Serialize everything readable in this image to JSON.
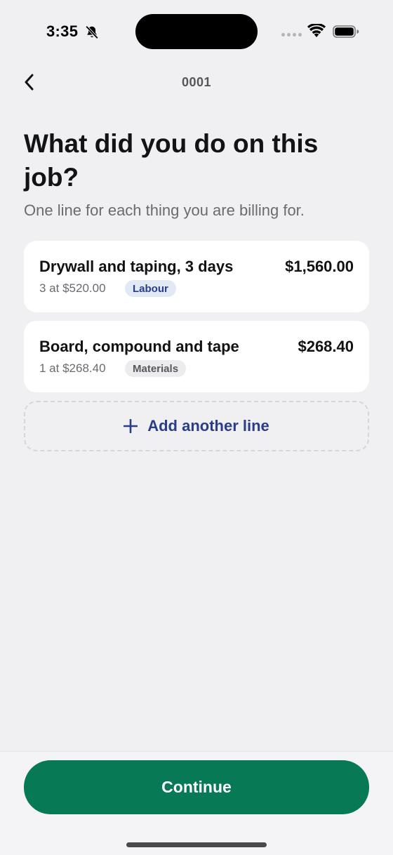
{
  "status_bar": {
    "time": "3:35",
    "icons": [
      "bell-slash-icon",
      "signal-icon",
      "wifi-icon",
      "battery-icon"
    ]
  },
  "nav": {
    "back_icon": "chevron-left-icon",
    "title": "0001"
  },
  "heading": {
    "title": "What did you do on this job?",
    "subtitle": "One line for each thing you are billing for."
  },
  "line_items": [
    {
      "title": "Drywall and taping, 3 days",
      "amount": "$1,560.00",
      "detail": "3 at $520.00",
      "tag": "Labour"
    },
    {
      "title": "Board, compound and tape",
      "amount": "$268.40",
      "detail": "1 at $268.40",
      "tag": "Materials"
    }
  ],
  "add_line": {
    "icon": "plus-icon",
    "label": "Add another line"
  },
  "footer": {
    "continue_label": "Continue"
  },
  "colors": {
    "background": "#f0f0f2",
    "accent_green": "#077955",
    "accent_blue": "#2a3d87",
    "labour_tag_bg": "#e3e8f5",
    "materials_tag_bg": "#ececee"
  }
}
